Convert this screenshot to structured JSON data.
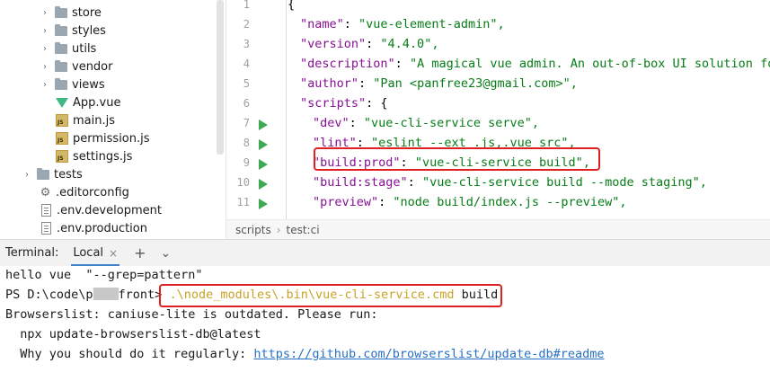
{
  "tree": {
    "items": [
      {
        "label": "store",
        "type": "folder",
        "chevron": "›"
      },
      {
        "label": "styles",
        "type": "folder",
        "chevron": "›"
      },
      {
        "label": "utils",
        "type": "folder",
        "chevron": "›"
      },
      {
        "label": "vendor",
        "type": "folder",
        "chevron": "›"
      },
      {
        "label": "views",
        "type": "folder",
        "chevron": "›"
      },
      {
        "label": "App.vue",
        "type": "vue"
      },
      {
        "label": "main.js",
        "type": "js"
      },
      {
        "label": "permission.js",
        "type": "js"
      },
      {
        "label": "settings.js",
        "type": "js"
      },
      {
        "label": "tests",
        "type": "folder",
        "chevron": "›"
      },
      {
        "label": ".editorconfig",
        "type": "gear"
      },
      {
        "label": ".env.development",
        "type": "file"
      },
      {
        "label": ".env.production",
        "type": "file"
      }
    ]
  },
  "editor": {
    "lines": [
      {
        "num": "1",
        "key": "",
        "value": "{"
      },
      {
        "num": "2",
        "key": "\"name\"",
        "value": "\"vue-element-admin\","
      },
      {
        "num": "3",
        "key": "\"version\"",
        "value": "\"4.4.0\","
      },
      {
        "num": "4",
        "key": "\"description\"",
        "value": "\"A magical vue admin. An out-of-box UI solution fo"
      },
      {
        "num": "5",
        "key": "\"author\"",
        "value": "\"Pan <panfree23@gmail.com>\","
      },
      {
        "num": "6",
        "key": "\"scripts\"",
        "value": "{"
      },
      {
        "num": "7",
        "key": "\"dev\"",
        "value": "\"vue-cli-service serve\","
      },
      {
        "num": "8",
        "key": "\"lint\"",
        "value": "\"eslint --ext .js,.vue src\","
      },
      {
        "num": "9",
        "key": "\"build:prod\"",
        "value": "\"vue-cli-service build\","
      },
      {
        "num": "10",
        "key": "\"build:stage\"",
        "value": "\"vue-cli-service build --mode staging\","
      },
      {
        "num": "11",
        "key": "\"preview\"",
        "value": "\"node build/index.js --preview\","
      }
    ],
    "breadcrumb": [
      "scripts",
      "test:ci"
    ]
  },
  "terminal": {
    "title": "Terminal:",
    "tab_label": "Local",
    "close_glyph": "×",
    "add_glyph": "+",
    "menu_glyph": "⌄",
    "lines": {
      "l1": "hello vue  \"--grep=pattern\"",
      "prompt_prefix": "PS D:\\code\\p",
      "prompt_suffix": "front>",
      "command_path": ".\\node_modules\\.bin\\vue-cli-service.cmd",
      "command_arg": " build",
      "l3": "Browserslist: caniuse-lite is outdated. Please run:",
      "l4": "  npx update-browserslist-db@latest",
      "l5_prefix": "  Why you should do it regularly: ",
      "l5_link": "https://github.com/browserslist/update-db#readme"
    }
  },
  "colors": {
    "key": "#871094",
    "string": "#067d17",
    "highlight_box": "#e02020",
    "run_icon": "#3faa54",
    "command_path": "#c9a227",
    "link": "#2870c5"
  }
}
